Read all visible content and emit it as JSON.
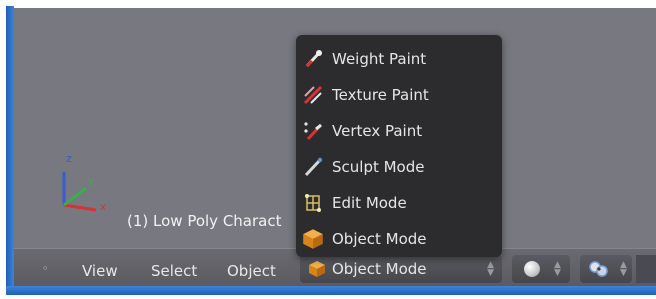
{
  "viewport": {
    "object_info": "(1) Low Poly Charact"
  },
  "mode_menu": {
    "items": [
      {
        "label": "Weight Paint",
        "icon": "weight-paint-icon"
      },
      {
        "label": "Texture Paint",
        "icon": "texture-paint-icon"
      },
      {
        "label": "Vertex Paint",
        "icon": "vertex-paint-icon"
      },
      {
        "label": "Sculpt Mode",
        "icon": "sculpt-mode-icon"
      },
      {
        "label": "Edit Mode",
        "icon": "edit-mode-icon"
      },
      {
        "label": "Object Mode",
        "icon": "object-mode-icon"
      }
    ]
  },
  "header": {
    "toggle": "◦",
    "view_label": "View",
    "select_label": "Select",
    "object_label": "Object",
    "mode_value": "Object Mode",
    "shading_icon": "solid-shading-icon",
    "pivot_icon": "pivot-point-icon"
  },
  "colors": {
    "viewport_bg": "#777880",
    "menu_bg": "#2c2c2e",
    "header_bg": "#5a5a60",
    "window_border": "#2f72c8"
  }
}
